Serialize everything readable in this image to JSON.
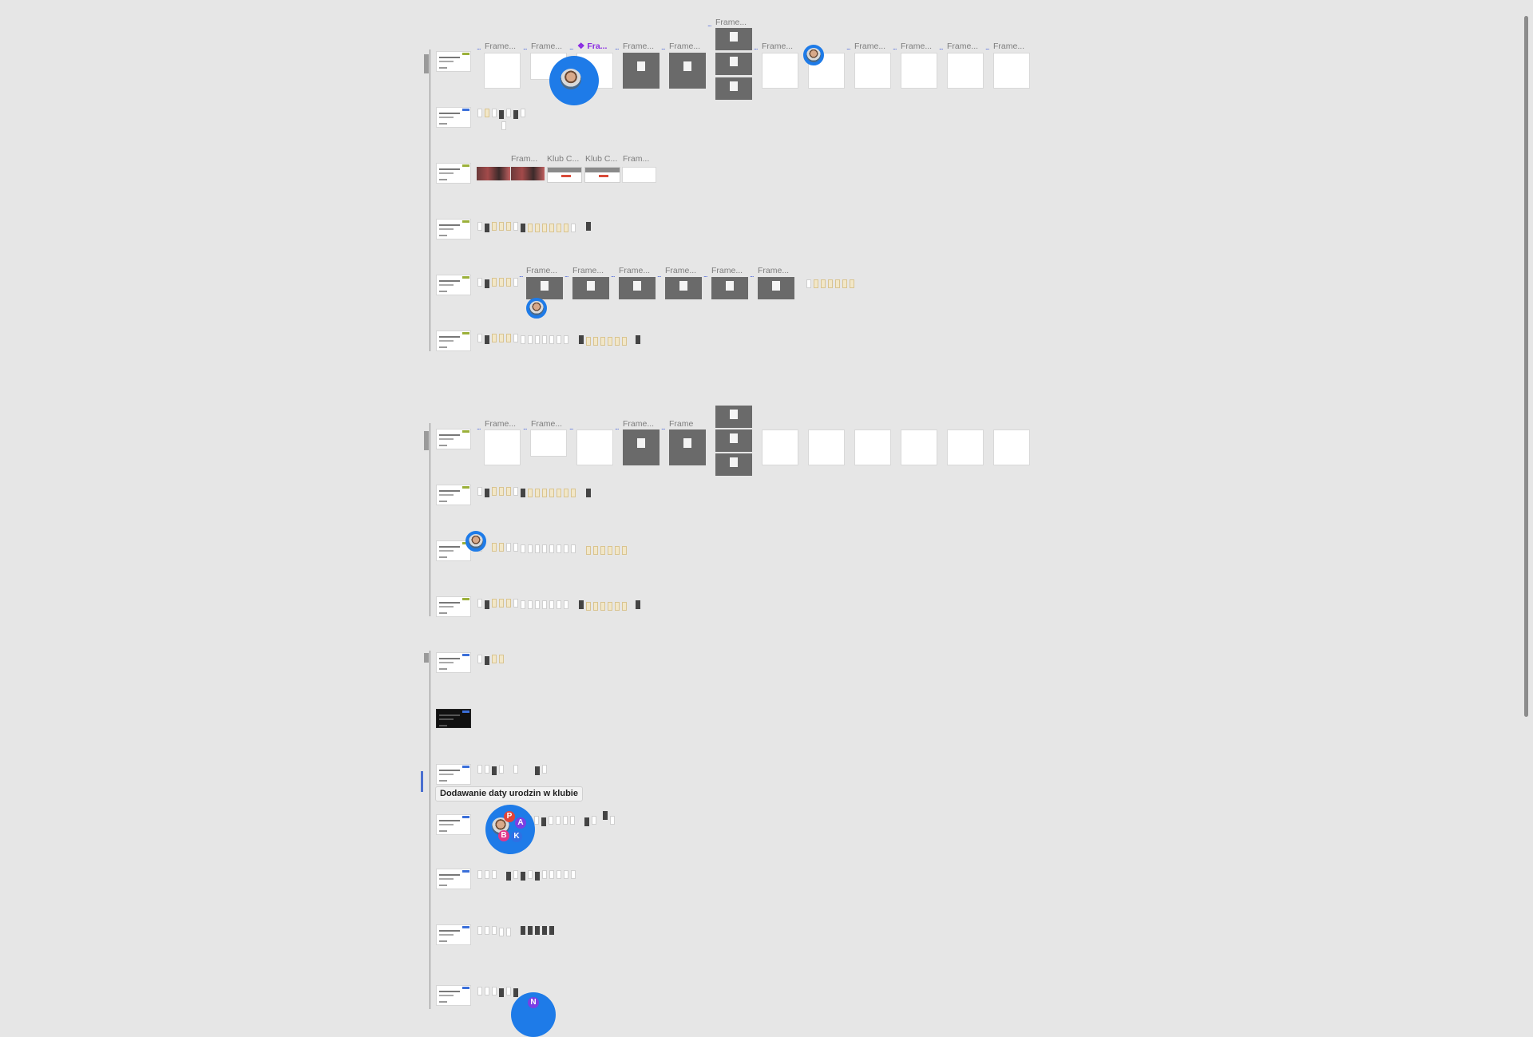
{
  "canvas": {
    "background": "#e6e6e6"
  },
  "frame_labels": {
    "frame": "Frame...",
    "component": "❖ Fra...",
    "fram": "Fram...",
    "klub": "Klub C...",
    "frame_full": "Frame"
  },
  "connector_dots": "...",
  "tooltip": {
    "label": "Dodawanie daty urodzin w klubie"
  },
  "collaborators": {
    "group_avatar_badges": [
      "P",
      "A",
      "B",
      "K"
    ],
    "bottom_avatar_badge": "N"
  },
  "colors": {
    "accent": "#1e7be8",
    "component_purple": "#8a2be2",
    "tag_green": "#9bb03a",
    "tag_blue": "#3b6fd9",
    "badge_red": "#e0443a",
    "badge_purple": "#7b3fe4",
    "badge_pink": "#e0368a",
    "badge_blue": "#2f6fe4"
  }
}
